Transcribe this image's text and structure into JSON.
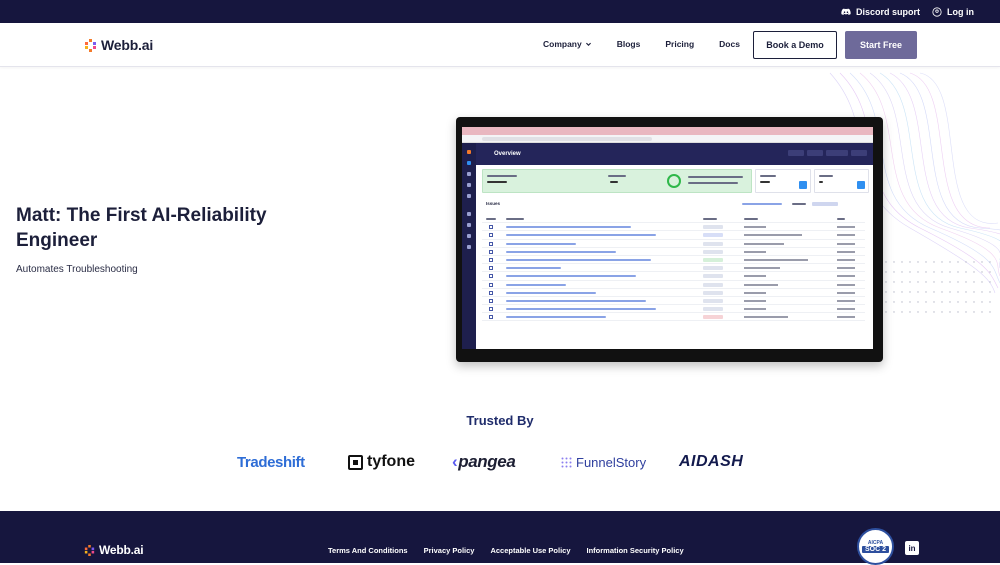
{
  "topbar": {
    "discord_label": "Discord suport",
    "login_label": "Log in",
    "discord_icon": "discord-icon",
    "login_icon": "user-circle-icon"
  },
  "navbar": {
    "logo_text": "Webb.ai",
    "links": [
      {
        "label": "Company",
        "has_dropdown": true
      },
      {
        "label": "Blogs"
      },
      {
        "label": "Pricing"
      },
      {
        "label": "Docs"
      }
    ],
    "book_demo_label": "Book a Demo",
    "start_free_label": "Start Free"
  },
  "hero": {
    "title": "Matt: The First AI-Reliability Engineer",
    "subtitle": "Automates Troubleshooting"
  },
  "preview": {
    "app_title": "Overview",
    "issues_label": "Issues"
  },
  "trusted": {
    "title": "Trusted By",
    "brands": [
      "Tradeshift",
      "tyfone",
      "pangea",
      "FunnelStory",
      "AIDASH"
    ]
  },
  "footer": {
    "logo_text": "Webb.ai",
    "links": [
      "Terms And Conditions",
      "Privacy Policy",
      "Acceptable Use Policy",
      "Information Security Policy"
    ],
    "badge_top": "AICPA",
    "badge_mid": "SOC 2",
    "linkedin_icon": "linkedin-icon"
  },
  "colors": {
    "navy": "#16163e",
    "accent_orange": "#f47a2a",
    "start_button": "#6e6a9a"
  }
}
